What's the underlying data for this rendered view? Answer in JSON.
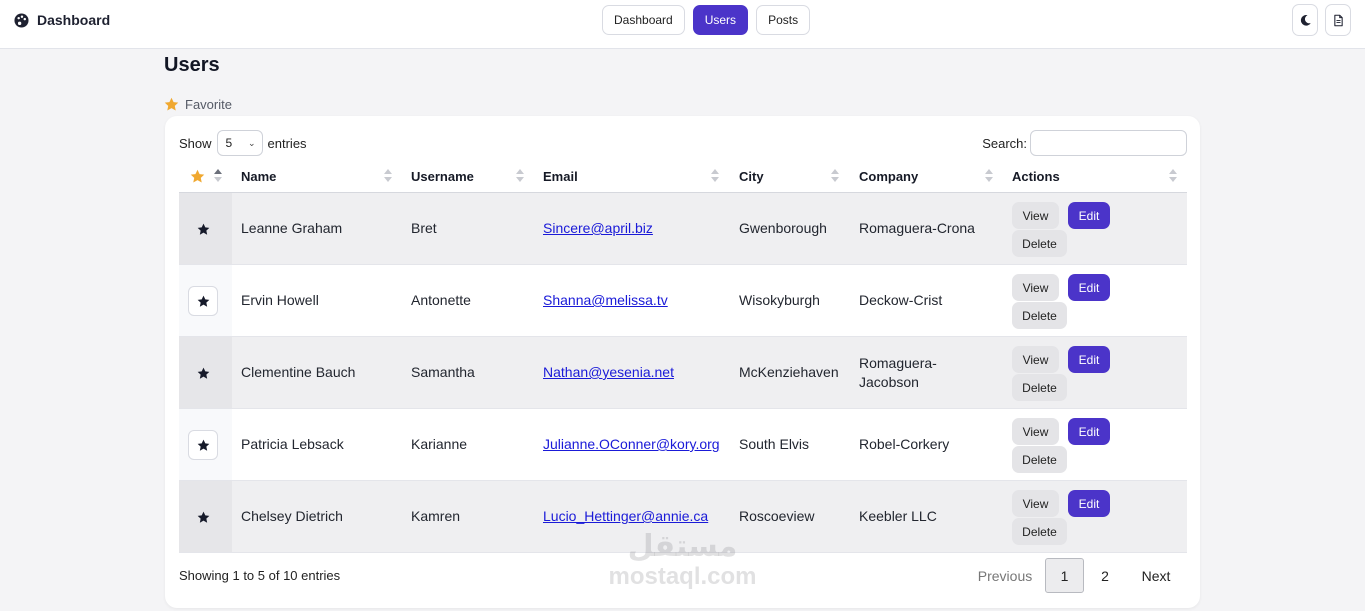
{
  "brand": {
    "title": "Dashboard",
    "icon": "palette-icon"
  },
  "nav": {
    "tabs": [
      {
        "label": "Dashboard"
      },
      {
        "label": "Users"
      },
      {
        "label": "Posts"
      }
    ]
  },
  "header_icons": [
    "moon-icon",
    "document-icon"
  ],
  "page": {
    "title": "Users",
    "favorite_label": "Favorite"
  },
  "table_controls": {
    "show_label": "Show",
    "page_size": "5",
    "entries_label": "entries",
    "search_label": "Search:",
    "search_value": ""
  },
  "columns": [
    "Name",
    "Username",
    "Email",
    "City",
    "Company",
    "Actions"
  ],
  "rows": [
    {
      "name": "Leanne Graham",
      "username": "Bret",
      "email": "Sincere@april.biz",
      "city": "Gwenborough",
      "company": "Romaguera-Crona"
    },
    {
      "name": "Ervin Howell",
      "username": "Antonette",
      "email": "Shanna@melissa.tv",
      "city": "Wisokyburgh",
      "company": "Deckow-Crist"
    },
    {
      "name": "Clementine Bauch",
      "username": "Samantha",
      "email": "Nathan@yesenia.net",
      "city": "McKenziehaven",
      "company": "Romaguera-Jacobson"
    },
    {
      "name": "Patricia Lebsack",
      "username": "Karianne",
      "email": "Julianne.OConner@kory.org",
      "city": "South Elvis",
      "company": "Robel-Corkery"
    },
    {
      "name": "Chelsey Dietrich",
      "username": "Kamren",
      "email": "Lucio_Hettinger@annie.ca",
      "city": "Roscoeview",
      "company": "Keebler LLC"
    }
  ],
  "actions": {
    "view": "View",
    "edit": "Edit",
    "delete": "Delete"
  },
  "footer": {
    "info": "Showing 1 to 5 of 10 entries"
  },
  "pagination": {
    "previous": "Previous",
    "pages": [
      "1",
      "2"
    ],
    "current": "1",
    "next": "Next"
  },
  "watermark": {
    "arabic": "مستقل",
    "latin": "mostaql.com"
  },
  "colors": {
    "accent": "#4b34c9",
    "star": "#f0a830",
    "link": "#1a1ad8"
  }
}
